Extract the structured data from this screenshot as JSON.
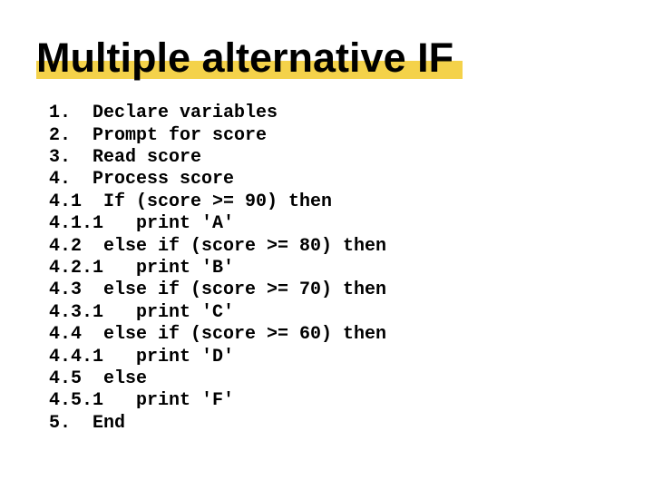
{
  "title": "Multiple alternative IF",
  "code_lines": [
    "1.  Declare variables",
    "2.  Prompt for score",
    "3.  Read score",
    "4.  Process score",
    "4.1  If (score >= 90) then",
    "4.1.1   print 'A'",
    "4.2  else if (score >= 80) then",
    "4.2.1   print 'B'",
    "4.3  else if (score >= 70) then",
    "4.3.1   print 'C'",
    "4.4  else if (score >= 60) then",
    "4.4.1   print 'D'",
    "4.5  else",
    "4.5.1   print 'F'",
    "5.  End"
  ]
}
